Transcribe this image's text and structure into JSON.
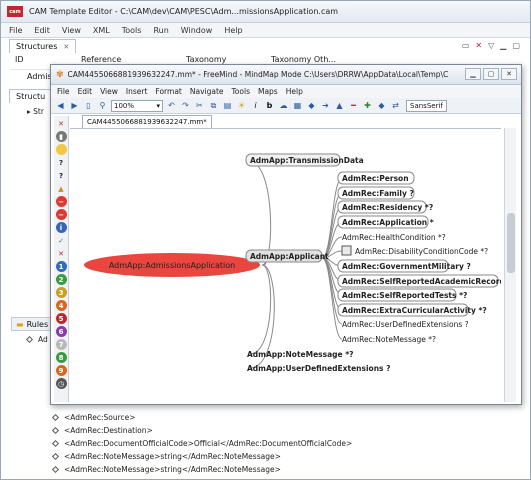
{
  "cam": {
    "title": "CAM Template Editor - C:\\CAM\\dev\\CAM\\PESC\\Adm...missionsApplication.cam",
    "logo_text": "cam",
    "menu": [
      "File",
      "Edit",
      "View",
      "XML",
      "Tools",
      "Run",
      "Window",
      "Help"
    ],
    "structures_tab": "Structures",
    "struct_tab2": "Structu",
    "columns": [
      "ID",
      "Reference",
      "Taxonomy",
      "Taxonomy Oth..."
    ],
    "row1": "Admiss",
    "row2": "Str",
    "rules_tab": "Rules",
    "rules_item": "Ad",
    "tree_lines": [
      "<AdmRec:Source>",
      "<AdmRec:Destination>",
      "<AdmRec:DocumentOfficialCode>Official</AdmRec:DocumentOfficialCode>",
      "<AdmRec:NoteMessage>string</AdmRec:NoteMessage>",
      "<AdmRec:NoteMessage>string</AdmRec:NoteMessage>"
    ]
  },
  "fm": {
    "title": "CAM4455066881939632247.mm* - FreeMind - MindMap Mode C:\\Users\\DRRW\\AppData\\Local\\Temp\\CAM44550...",
    "menu": [
      "File",
      "Edit",
      "View",
      "Insert",
      "Format",
      "Navigate",
      "Tools",
      "Maps",
      "Help"
    ],
    "zoom": "100%",
    "font": "SansSerif",
    "doc_tab": "CAM4455066881939632247.mm*",
    "nodes": {
      "root": "AdmApp:AdmissionsApplication",
      "transmission": "AdmApp:TransmissionData",
      "applicant": "AdmApp:Applicant",
      "person": "AdmRec:Person",
      "family": "AdmRec:Family ?",
      "residency": "AdmRec:Residency *?",
      "application": "AdmRec:Application *",
      "health": "AdmRec:HealthCondition *?",
      "disability": "AdmRec:DisabilityConditionCode *?",
      "government": "AdmRec:GovernmentMilitary ?",
      "academic": "AdmRec:SelfReportedAcademicRecord *?",
      "tests": "AdmRec:SelfReportedTests *?",
      "extra": "AdmRec:ExtraCurricularActivity *?",
      "userdef_rec": "AdmRec:UserDefinedExtensions ?",
      "note_rec": "AdmRec:NoteMessage *?",
      "note_app": "AdmApp:NoteMessage *?",
      "userdef_app": "AdmApp:UserDefinedExtensions ?"
    },
    "colors": {
      "root": "#e8463f",
      "node_border": "#8a8a8a",
      "edge": "#8a8a8a"
    }
  }
}
